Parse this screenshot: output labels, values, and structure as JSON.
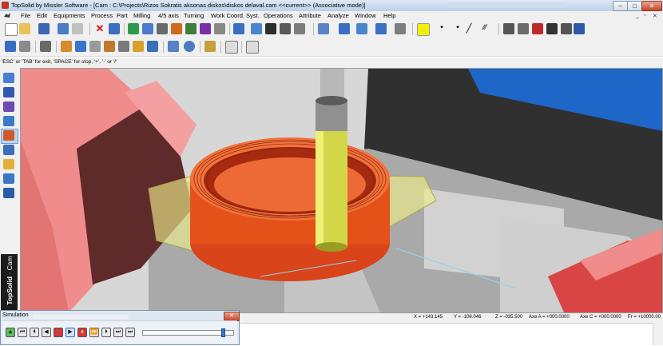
{
  "window": {
    "title": "TopSolid by Missler Software - [Cam : C:\\Projects\\Rizos Sokratis aksonas diskos\\diskos delaval.cam <<current>> (Associative mode)]",
    "minimize": "–",
    "maximize": "□",
    "close": "✕"
  },
  "menu": {
    "items": [
      "File",
      "Edit",
      "Equipments",
      "Process",
      "Part",
      "Milling",
      "4/5 axis",
      "Turning",
      "Work Coord. Syst.",
      "Operations",
      "Attribute",
      "Analyze",
      "Window",
      "Help"
    ],
    "mdi_minimize": "_",
    "mdi_restore": "▫",
    "mdi_close": "✕"
  },
  "hint": "'ESC' or 'TAB' for exit, 'SPACE' for stop, '+', '-' or '/'",
  "brand": {
    "top": "TopSolid",
    "bottom": "Cam"
  },
  "status": {
    "x": "X = +143.145",
    "y": "Y = -108.046",
    "z": "Z = -035.500",
    "axe_a": "Axe A = +000.0000",
    "axe_c": "Axe C = +000.0000",
    "fr": "Fr = +10000.00"
  },
  "simulation": {
    "title": "Simulation",
    "close": "✕"
  },
  "colors": {
    "accent_red": "#c8321e",
    "tool_yellow": "#d4d64a",
    "part_orange": "#e4521a"
  }
}
